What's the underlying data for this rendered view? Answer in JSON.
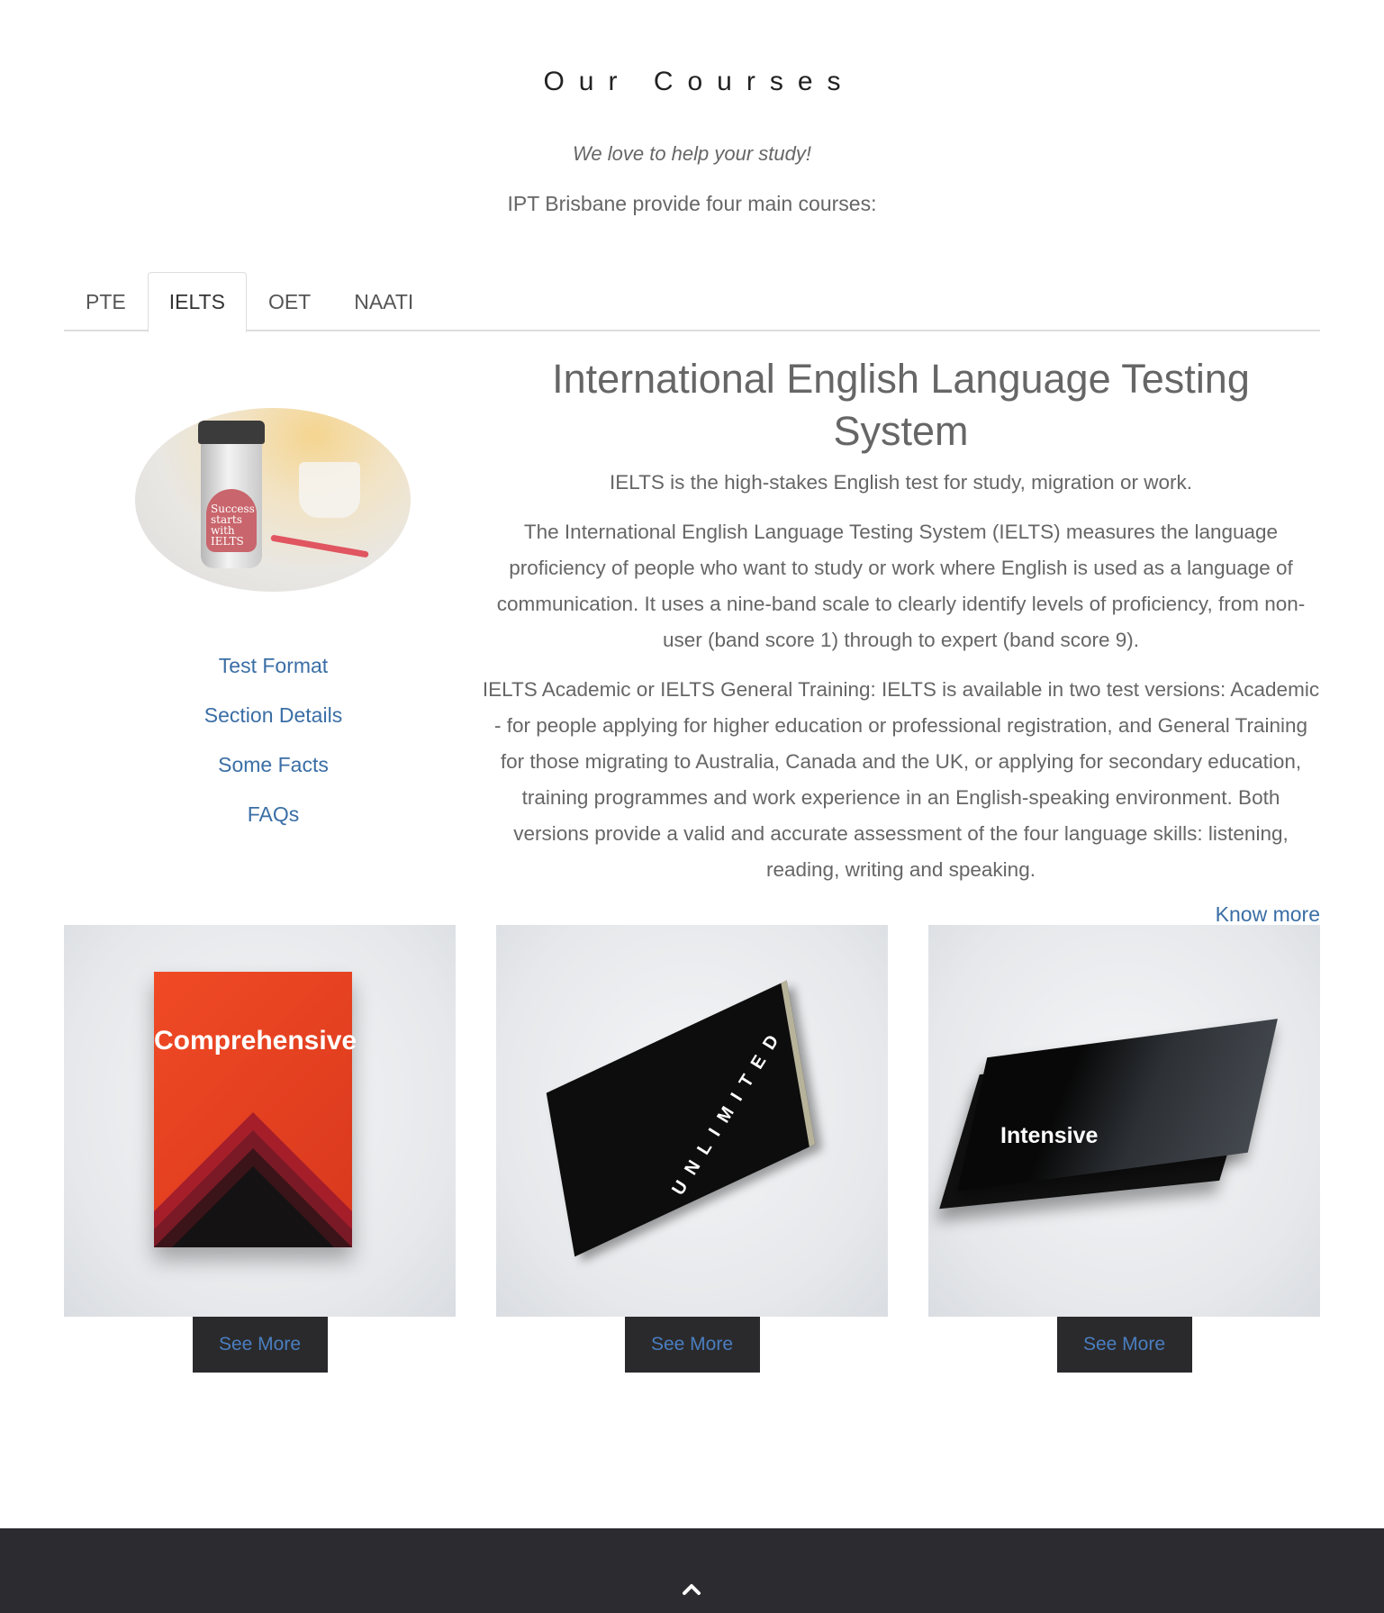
{
  "section": {
    "heading": "Our Courses",
    "tagline": "We love to help your study!",
    "intro": "IPT Brisbane provide four main courses:"
  },
  "tabs": [
    {
      "label": "PTE",
      "active": false
    },
    {
      "label": "IELTS",
      "active": true
    },
    {
      "label": "OET",
      "active": false
    },
    {
      "label": "NAATI",
      "active": false
    }
  ],
  "image": {
    "cup_text": "Success starts with IELTS"
  },
  "side_links": [
    "Test Format",
    "Section Details",
    "Some Facts",
    "FAQs"
  ],
  "content": {
    "title": "International English Language Testing System",
    "lead": "IELTS is the high-stakes English test for study, migration or work.",
    "para1": "The International English Language Testing System (IELTS) measures the language proficiency of people who want to study or work where English is used as a language of communication. It uses a nine-band scale to clearly identify levels of proficiency, from non-user (band score 1) through to expert (band score 9).",
    "para2": "IELTS Academic or IELTS General Training: IELTS is available in two test versions: Academic - for people applying for higher education or professional registration, and General Training for those migrating to Australia, Canada and the UK, or applying for secondary education, training programmes and work experience in an English-speaking environment. Both versions provide a valid and accurate assessment of the four language skills: listening, reading, writing and speaking.",
    "know_more": "Know more"
  },
  "cards": [
    {
      "book_title": "Comprehensive",
      "button": "See More"
    },
    {
      "book_title": "UNLIMITED",
      "button": "See More"
    },
    {
      "book_title": "Intensive",
      "button": "See More"
    }
  ],
  "colors": {
    "link": "#3a6ea5",
    "footer_bg": "#2b2b30",
    "button_bg": "#2a2a2c",
    "comprehensive_cover": "#e8401f"
  },
  "footer": {
    "icon": "chevron-up-icon"
  }
}
